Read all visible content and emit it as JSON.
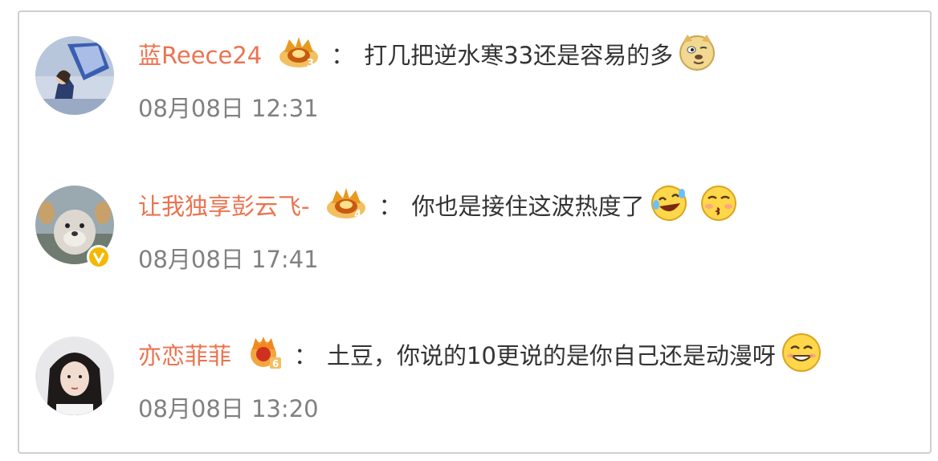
{
  "comments": [
    {
      "username": "蓝Reece24",
      "level": "3",
      "separator": "：",
      "text": "打几把逆水寒33还是容易的多",
      "emojis": [
        "doge-emoji"
      ],
      "timestamp": "08月08日 12:31",
      "verified": false
    },
    {
      "username": "让我独享彭云飞-",
      "level": "4",
      "separator": "：",
      "text": "你也是接住这波热度了",
      "emojis": [
        "laugh-cry-emoji",
        "kiss-emoji"
      ],
      "timestamp": "08月08日 17:41",
      "verified": true
    },
    {
      "username": "亦恋菲菲",
      "level": "6",
      "separator": "：",
      "text": "土豆，你说的10更说的是你自己还是动漫呀",
      "emojis": [
        "grin-emoji"
      ],
      "timestamp": "08月08日 13:20",
      "verified": false
    }
  ],
  "colors": {
    "username": "#eb7350",
    "text": "#333333",
    "timestamp": "#808080",
    "border": "#cfcfcf",
    "crown": "#f0a020"
  }
}
